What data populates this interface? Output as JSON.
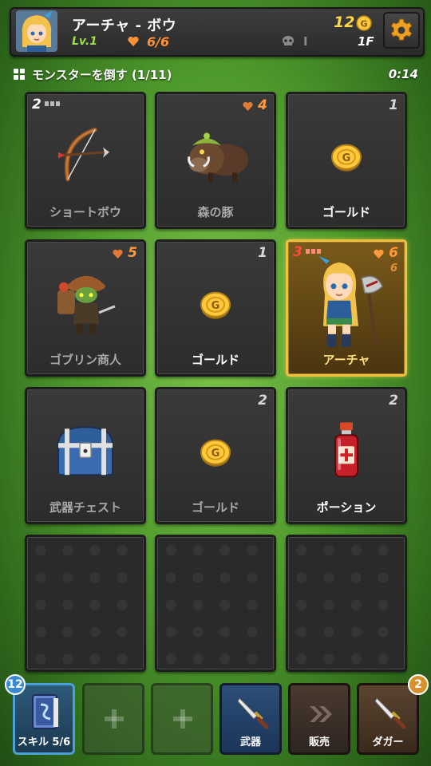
{
  "header": {
    "hero_name": "アーチャ - ボウ",
    "level": "Lv.1",
    "hp": "6/6",
    "gold": "12",
    "kills": "I",
    "floor": "1F"
  },
  "quest": {
    "text": "モンスターを倒す (1/11)",
    "timer": "0:14"
  },
  "cards": [
    {
      "label": "ショートボウ",
      "level": "2",
      "icon": "bow-icon"
    },
    {
      "label": "森の豚",
      "hp": "4",
      "icon": "boar-icon"
    },
    {
      "label": "ゴールド",
      "value": "1",
      "icon": "gold-coin-icon"
    },
    {
      "label": "ゴブリン商人",
      "hp": "5",
      "icon": "goblin-merchant-icon"
    },
    {
      "label": "ゴールド",
      "value": "1",
      "icon": "gold-coin-icon"
    },
    {
      "label": "アーチャ",
      "level": "3",
      "hp": "6",
      "max_hp": "6",
      "icon": "archer-hero-icon"
    },
    {
      "label": "武器チェスト",
      "icon": "treasure-chest-icon"
    },
    {
      "label": "ゴールド",
      "value": "2",
      "icon": "gold-coin-icon"
    },
    {
      "label": "ポーション",
      "value": "2",
      "icon": "potion-icon"
    }
  ],
  "bottom": {
    "skill_label": "スキル 5/6",
    "skill_badge": "12",
    "weapon_label": "武器",
    "sell_label": "販売",
    "dagger_label": "ダガー",
    "dagger_badge": "2"
  },
  "colors": {
    "gold": "#ffd54a",
    "hp": "#ff9138",
    "level": "#9be04a",
    "hero_border": "#f0c040"
  }
}
